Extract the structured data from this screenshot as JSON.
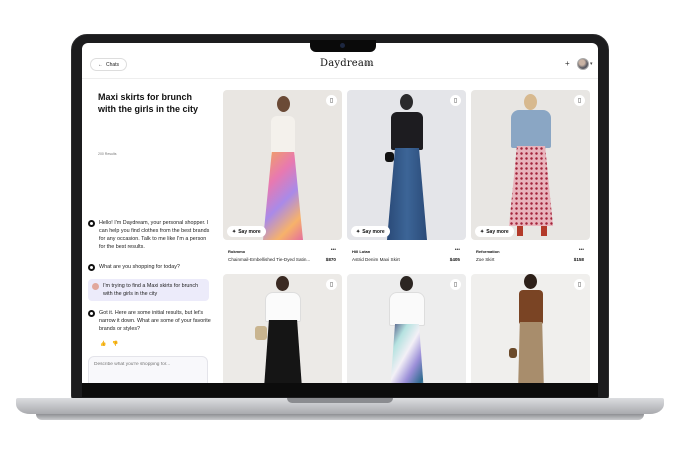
{
  "app": {
    "logo": "Daydream",
    "badge": "BETA",
    "chats_label": "Chats"
  },
  "query": {
    "title": "Maxi skirts for brunch with the girls in the city",
    "results": "200 Results"
  },
  "chat": [
    {
      "role": "bot",
      "text": "Hello! I'm Daydream, your personal shopper. I can help you find clothes from the best brands for any occasion. Talk to me like I'm a person for the best results."
    },
    {
      "role": "bot",
      "text": "What are you shopping for today?"
    },
    {
      "role": "user",
      "text": "I'm trying to find a Maxi skirts for brunch with the girls in the city"
    },
    {
      "role": "bot",
      "text": "Got it. Here are some initial results, but let's narrow it down. What are some of your favorite brands or styles?"
    }
  ],
  "composer": {
    "placeholder": "Describe what you're shopping for..."
  },
  "say_more_label": "Say more",
  "products": [
    {
      "brand": "Rokmmo",
      "name": "Chainmail-Embellished Tie-Dyed Satin...",
      "price": "$870"
    },
    {
      "brand": "Hill Lotan",
      "name": "Astrid Denim Maxi Skirt",
      "price": "$405"
    },
    {
      "brand": "Reformation",
      "name": "Zoe Skirt",
      "price": "$158"
    }
  ],
  "icons": [
    "back-arrow-icon",
    "plus-icon",
    "chevron-down-icon",
    "bookmark-icon",
    "sparkle-icon",
    "more-icon",
    "thumbs-up-icon",
    "thumbs-down-icon",
    "image-icon",
    "mic-icon",
    "chat-icon",
    "send-arrow-icon"
  ],
  "colors": {
    "accent": "#3a2fd0",
    "user_bubble": "#ecebfa",
    "frame": "#1c1c1e"
  }
}
